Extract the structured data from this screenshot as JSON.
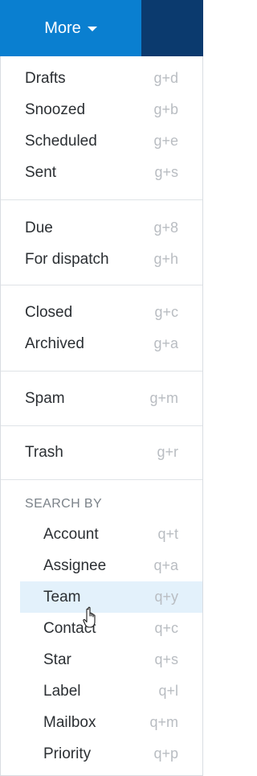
{
  "header": {
    "more_label": "More"
  },
  "colors": {
    "primary": "#0a7fd0",
    "dark": "#0b3a6e",
    "hover": "#e3f1fb"
  },
  "groups": [
    {
      "items": [
        {
          "label": "Drafts",
          "shortcut": "g+d"
        },
        {
          "label": "Snoozed",
          "shortcut": "g+b"
        },
        {
          "label": "Scheduled",
          "shortcut": "g+e"
        },
        {
          "label": "Sent",
          "shortcut": "g+s"
        }
      ]
    },
    {
      "items": [
        {
          "label": "Due",
          "shortcut": "g+8"
        },
        {
          "label": "For dispatch",
          "shortcut": "g+h"
        }
      ]
    },
    {
      "items": [
        {
          "label": "Closed",
          "shortcut": "g+c"
        },
        {
          "label": "Archived",
          "shortcut": "g+a"
        }
      ]
    },
    {
      "items": [
        {
          "label": "Spam",
          "shortcut": "g+m"
        }
      ]
    },
    {
      "items": [
        {
          "label": "Trash",
          "shortcut": "g+r"
        }
      ]
    }
  ],
  "search_by": {
    "title": "SEARCH BY",
    "items": [
      {
        "label": "Account",
        "shortcut": "q+t"
      },
      {
        "label": "Assignee",
        "shortcut": "q+a"
      },
      {
        "label": "Team",
        "shortcut": "q+y"
      },
      {
        "label": "Contact",
        "shortcut": "q+c"
      },
      {
        "label": "Star",
        "shortcut": "q+s"
      },
      {
        "label": "Label",
        "shortcut": "q+l"
      },
      {
        "label": "Mailbox",
        "shortcut": "q+m"
      },
      {
        "label": "Priority",
        "shortcut": "q+p"
      }
    ]
  }
}
